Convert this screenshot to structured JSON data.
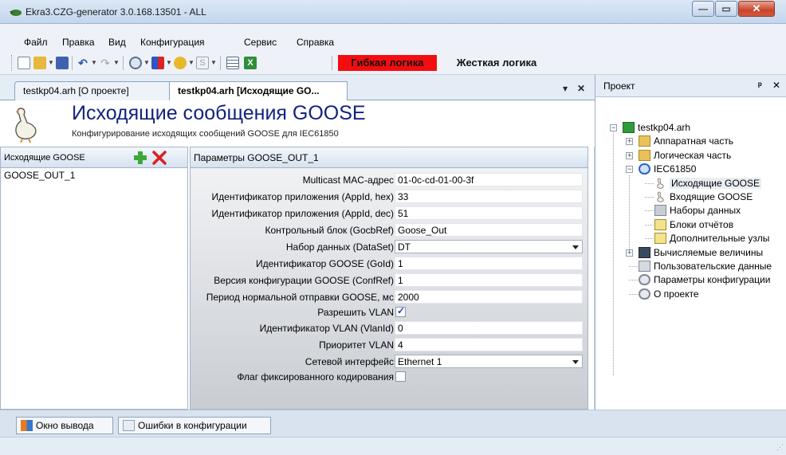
{
  "window": {
    "title": "Ekra3.CZG-generator 3.0.168.13501 - ALL",
    "min_glyph": "—",
    "max_glyph": "▭",
    "close_glyph": "✕"
  },
  "menu": [
    "Файл",
    "Правка",
    "Вид",
    "Конфигурация",
    "Сервис",
    "Справка"
  ],
  "toolbar": {
    "flexible_logic": "Гибкая логика",
    "hard_logic": "Жесткая логика",
    "colors": {
      "flexible_logic_bg": "#f30d10"
    }
  },
  "doc_tabs": [
    {
      "label": "testkp04.arh [О проекте]"
    },
    {
      "label": "testkp04.arh [Исходящие GO..."
    }
  ],
  "doc_tab_controls": {
    "dropdown": "▾",
    "close": "✕"
  },
  "header": {
    "title": "Исходящие сообщения GOOSE",
    "subtitle": "Конфигурирование исходящих сообщений GOOSE для IEC61850"
  },
  "left_pane": {
    "title": "Исходящие GOOSE",
    "items": [
      "GOOSE_OUT_1"
    ]
  },
  "params": {
    "title": "Параметры GOOSE_OUT_1",
    "rows": [
      {
        "label": "Multicast MAC-адрес",
        "value": "01-0c-cd-01-00-3f",
        "kind": "text"
      },
      {
        "label": "Идентификатор приложения (AppId, hex)",
        "value": "33",
        "kind": "text"
      },
      {
        "label": "Идентификатор приложения (AppId, dec)",
        "value": "51",
        "kind": "text"
      },
      {
        "label": "Контрольный блок (GocbRef)",
        "value": "Goose_Out",
        "kind": "text"
      },
      {
        "label": "Набор данных (DataSet)",
        "value": "DT",
        "kind": "select"
      },
      {
        "label": "Идентификатор GOOSE (GoId)",
        "value": "1",
        "kind": "text"
      },
      {
        "label": "Версия конфигурации GOOSE (ConfRef)",
        "value": "1",
        "kind": "text"
      },
      {
        "label": "Период нормальной отправки GOOSE, мс",
        "value": "2000",
        "kind": "text"
      },
      {
        "label": "Разрешить VLAN",
        "checked": true,
        "kind": "checkbox"
      },
      {
        "label": "Идентификатор VLAN (VlanId)",
        "value": "0",
        "kind": "text"
      },
      {
        "label": "Приоритет VLAN",
        "value": "4",
        "kind": "text"
      },
      {
        "label": "Сетевой интерфейс",
        "value": "Ethernet 1",
        "kind": "select"
      },
      {
        "label": "Флаг фиксированного кодирования",
        "checked": false,
        "kind": "checkbox"
      }
    ]
  },
  "project": {
    "title": "Проект",
    "pin": "ᵖ",
    "close": "✕",
    "tree": [
      {
        "label": "testkp04.arh",
        "icon": "project-icon",
        "level": 0,
        "expander": "−"
      },
      {
        "label": "Аппаратная часть",
        "icon": "folder-icon",
        "level": 1,
        "expander": "+"
      },
      {
        "label": "Логическая часть",
        "icon": "folder-icon",
        "level": 1,
        "expander": "+"
      },
      {
        "label": "IEC61850",
        "icon": "network-icon",
        "level": 1,
        "expander": "−"
      },
      {
        "label": "Исходящие GOOSE",
        "icon": "goose-icon",
        "level": 2,
        "selected": true
      },
      {
        "label": "Входящие GOOSE",
        "icon": "goose-icon",
        "level": 2
      },
      {
        "label": "Наборы данных",
        "icon": "dataset-icon",
        "level": 2
      },
      {
        "label": "Блоки отчётов",
        "icon": "report-icon",
        "level": 2
      },
      {
        "label": "Дополнительные узлы",
        "icon": "report-icon",
        "level": 2
      },
      {
        "label": "Вычисляемые величины",
        "icon": "calc-icon",
        "level": 1,
        "expander": "+"
      },
      {
        "label": "Пользовательские данные",
        "icon": "userdata-icon",
        "level": 1
      },
      {
        "label": "Параметры конфигурации",
        "icon": "gear-icon",
        "level": 1
      },
      {
        "label": "О проекте",
        "icon": "gear-icon",
        "level": 1
      }
    ]
  },
  "bottom_tabs": [
    {
      "label": "Окно вывода",
      "icon": "output-window-icon"
    },
    {
      "label": "Ошибки в конфигурации",
      "icon": "errors-icon"
    }
  ],
  "statusbar": {
    "grip": "⋰"
  }
}
